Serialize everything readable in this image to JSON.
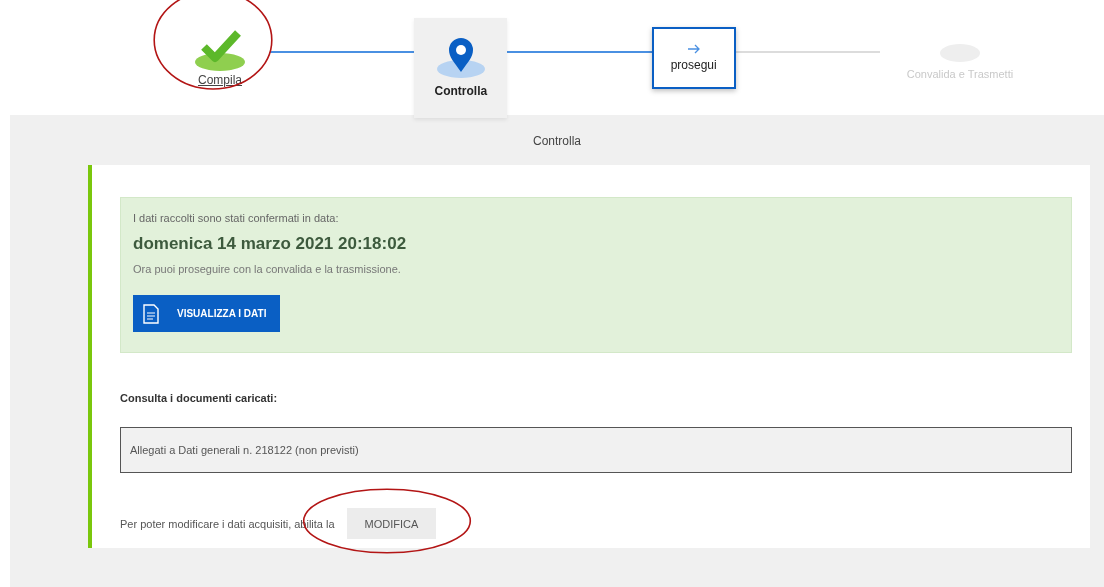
{
  "steps": [
    {
      "label": "Compila",
      "kind": "done",
      "highlighted": true
    },
    {
      "label": "Controlla",
      "kind": "current",
      "highlighted": false
    },
    {
      "label": "prosegui",
      "kind": "next",
      "highlighted": false
    },
    {
      "label": "Convalida e Trasmetti",
      "kind": "pending",
      "highlighted": false
    }
  ],
  "panel": {
    "title": "Controlla",
    "confirmation": {
      "intro": "I dati raccolti sono stati confermati in data:",
      "date": "domenica 14 marzo 2021 20:18:02",
      "note": "Ora puoi proseguire con la convalida e la trasmissione.",
      "button": "VISUALIZZA I DATI"
    },
    "documents_label": "Consulta i documenti caricati:",
    "documents": [
      "Allegati a Dati generali n. 218122 (non previsti)"
    ],
    "modify_text": "Per poter modificare i dati acquisiti, abilita la",
    "modify_button": {
      "label": "MODIFICA",
      "highlighted": true
    }
  }
}
